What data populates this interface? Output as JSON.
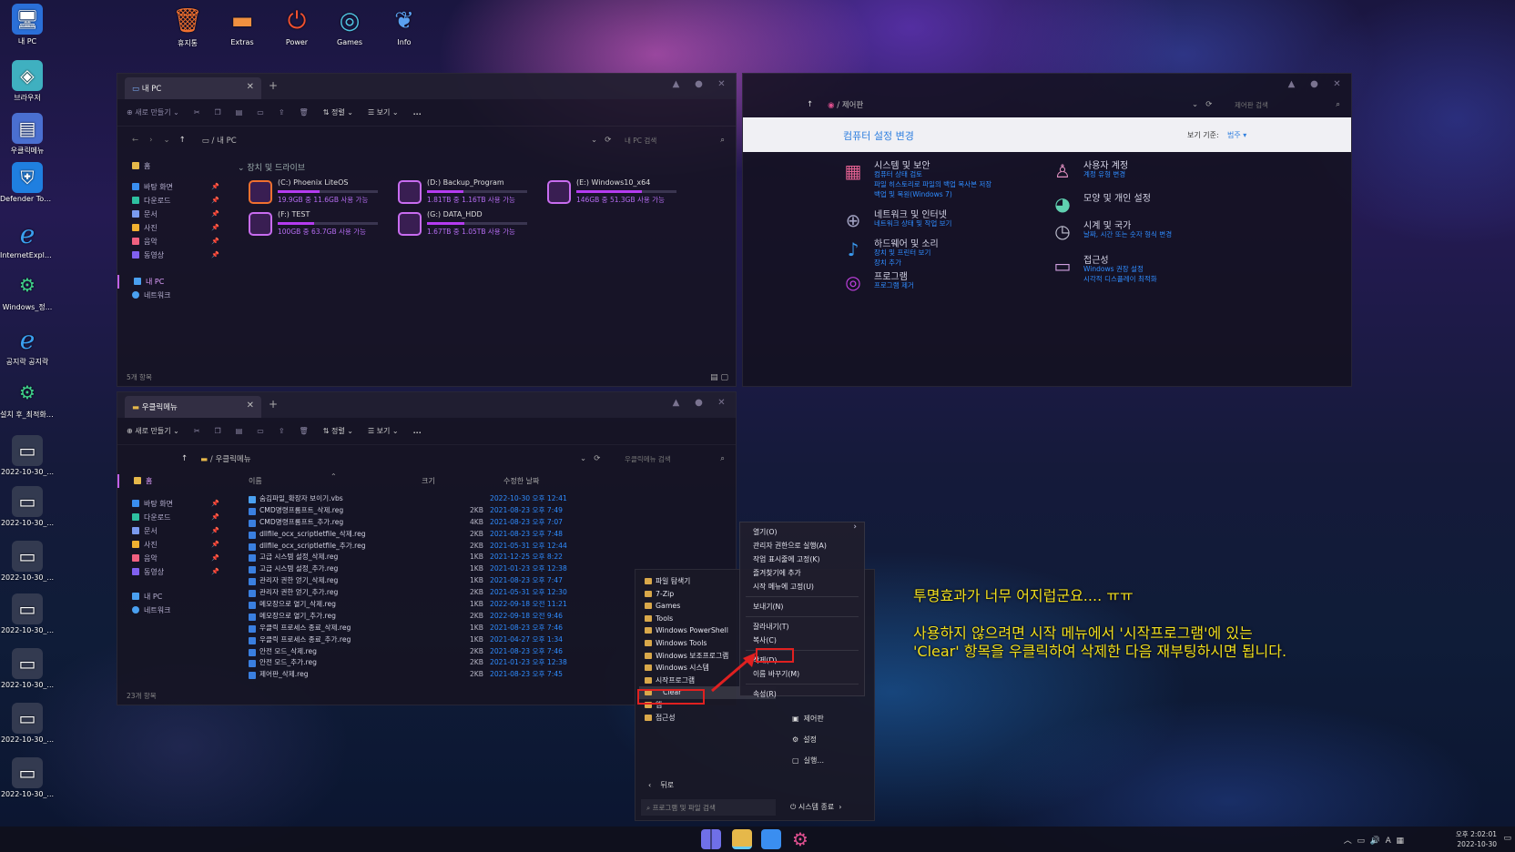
{
  "desktop": {
    "left_icons": [
      {
        "label": "내 PC",
        "icon": "monitor-icon"
      },
      {
        "label": "브라우저",
        "icon": "browser-icon"
      },
      {
        "label": "우클릭메뉴",
        "icon": "context-menu-icon"
      },
      {
        "label": "Defender Tools.exe",
        "icon": "shield-icon"
      },
      {
        "label": "InternetExplor...",
        "icon": "ie-icon"
      },
      {
        "label": "Windows_정...",
        "icon": "gear-icon"
      },
      {
        "label": "공지락 공지락",
        "icon": "ie-icon"
      },
      {
        "label": "설치 후_최적화.cmd",
        "icon": "gear-icon"
      },
      {
        "label": "2022-10-30_...",
        "icon": "screenshot-icon"
      },
      {
        "label": "2022-10-30_...",
        "icon": "screenshot-icon"
      },
      {
        "label": "2022-10-30_...",
        "icon": "screenshot-icon"
      },
      {
        "label": "2022-10-30_...",
        "icon": "screenshot-icon"
      },
      {
        "label": "2022-10-30_...",
        "icon": "screenshot-icon"
      },
      {
        "label": "2022-10-30_...",
        "icon": "screenshot-icon"
      },
      {
        "label": "2022-10-30_...",
        "icon": "screenshot-icon"
      }
    ],
    "top_icons": [
      {
        "label": "휴지통",
        "icon": "trash-icon"
      },
      {
        "label": "Extras",
        "icon": "folder-icon"
      },
      {
        "label": "Power",
        "icon": "power-icon"
      },
      {
        "label": "Games",
        "icon": "gamepad-icon"
      },
      {
        "label": "Info",
        "icon": "bird-icon"
      }
    ]
  },
  "explorer1": {
    "tab": "내 PC",
    "toolbar": {
      "new": "새로 만들기",
      "sort": "정렬",
      "view": "보기",
      "more": "..."
    },
    "address": "내 PC",
    "search_placeholder": "내 PC 검색",
    "nav": {
      "home": "홈",
      "items": [
        "바탕 화면",
        "다운로드",
        "문서",
        "사진",
        "음악",
        "동영상"
      ],
      "pc": "내 PC",
      "network": "네트워크"
    },
    "section": "장치 및 드라이브",
    "drives": [
      {
        "name": "(C:) Phoenix LiteOS",
        "space": "19.9GB 중 11.6GB 사용 가능",
        "used": 0.42
      },
      {
        "name": "(D:) Backup_Program",
        "space": "1.81TB 중 1.16TB 사용 가능",
        "used": 0.36
      },
      {
        "name": "(E:) Windows10_x64",
        "space": "146GB 중 51.3GB 사용 가능",
        "used": 0.65
      },
      {
        "name": "(F:) TEST",
        "space": "100GB 중 63.7GB 사용 가능",
        "used": 0.36
      },
      {
        "name": "(G:) DATA_HDD",
        "space": "1.67TB 중 1.05TB 사용 가능",
        "used": 0.37
      }
    ],
    "status": "5개 항목"
  },
  "controlpanel": {
    "address": "제어판",
    "search_placeholder": "제어판 검색",
    "heading": "컴퓨터 설정 변경",
    "view_by_label": "보기 기준:",
    "view_by_value": "범주",
    "items": [
      {
        "title": "시스템 및 보안",
        "subs": [
          "컴퓨터 상태 검토",
          "파일 히스토리로 파일의 백업 복사본 저장",
          "백업 및 복원(Windows 7)"
        ]
      },
      {
        "title": "네트워크 및 인터넷",
        "subs": [
          "네트워크 상태 및 작업 보기"
        ]
      },
      {
        "title": "하드웨어 및 소리",
        "subs": [
          "장치 및 프린터 보기",
          "장치 추가"
        ]
      },
      {
        "title": "프로그램",
        "subs": [
          "프로그램 제거"
        ]
      },
      {
        "title": "사용자 계정",
        "subs": [
          "계정 유형 변경"
        ]
      },
      {
        "title": "모양 및 개인 설정",
        "subs": []
      },
      {
        "title": "시계 및 국가",
        "subs": [
          "날짜, 시간 또는 숫자 형식 변경"
        ]
      },
      {
        "title": "접근성",
        "subs": [
          "Windows 권장 설정",
          "시각적 디스플레이 최적화"
        ]
      }
    ]
  },
  "explorer2": {
    "tab": "우클릭메뉴",
    "toolbar": {
      "new": "새로 만들기",
      "sort": "정렬",
      "view": "보기",
      "more": "..."
    },
    "address": "우클릭메뉴",
    "search_placeholder": "우클릭메뉴 검색",
    "nav": {
      "home": "홈",
      "items": [
        "바탕 화면",
        "다운로드",
        "문서",
        "사진",
        "음악",
        "동영상"
      ],
      "pc": "내 PC",
      "network": "네트워크"
    },
    "columns": {
      "name": "이름",
      "size": "크기",
      "date": "수정한 날짜"
    },
    "files": [
      {
        "name": "숨김파일_확장자 보이기.vbs",
        "size": "",
        "date": "2022-10-30 오후 12:41"
      },
      {
        "name": "CMD명령프롬프트_삭제.reg",
        "size": "2KB",
        "date": "2021-08-23 오후 7:49"
      },
      {
        "name": "CMD명령프롬프트_추가.reg",
        "size": "4KB",
        "date": "2021-08-23 오후 7:07"
      },
      {
        "name": "dllfile_ocx_scriptletfile_삭제.reg",
        "size": "2KB",
        "date": "2021-08-23 오후 7:48"
      },
      {
        "name": "dllfile_ocx_scriptletfile_추가.reg",
        "size": "2KB",
        "date": "2021-05-31 오후 12:44"
      },
      {
        "name": "고급 시스템 설정_삭제.reg",
        "size": "1KB",
        "date": "2021-12-25 오후 8:22"
      },
      {
        "name": "고급 시스템 설정_추가.reg",
        "size": "1KB",
        "date": "2021-01-23 오후 12:38"
      },
      {
        "name": "관리자 권한 얻기_삭제.reg",
        "size": "1KB",
        "date": "2021-08-23 오후 7:47"
      },
      {
        "name": "관리자 권한 얻기_추가.reg",
        "size": "2KB",
        "date": "2021-05-31 오후 12:30"
      },
      {
        "name": "메모장으로 열기_삭제.reg",
        "size": "1KB",
        "date": "2022-09-18 오전 11:21"
      },
      {
        "name": "메모장으로 열기_추가.reg",
        "size": "2KB",
        "date": "2022-09-18 오전 9:46"
      },
      {
        "name": "우클릭 프로세스 종료_삭제.reg",
        "size": "1KB",
        "date": "2021-08-23 오후 7:46"
      },
      {
        "name": "우클릭 프로세스 종료_추가.reg",
        "size": "1KB",
        "date": "2021-04-27 오후 1:34"
      },
      {
        "name": "안전 모드_삭제.reg",
        "size": "2KB",
        "date": "2021-08-23 오후 7:46"
      },
      {
        "name": "안전 모드_추가.reg",
        "size": "2KB",
        "date": "2021-01-23 오후 12:38"
      },
      {
        "name": "제어판_삭제.reg",
        "size": "2KB",
        "date": "2021-08-23 오후 7:45"
      }
    ],
    "status": "23개 항목"
  },
  "startmenu": {
    "folders": [
      "파일 탐색기",
      "7-Zip",
      "Games",
      "Tools",
      "Windows PowerShell",
      "Windows Tools",
      "Windows 보조프로그램",
      "Windows 시스템",
      "시작프로그램",
      "Clear",
      "앱",
      "접근성"
    ],
    "back": "뒤로",
    "search_placeholder": "프로그램 및 파일 검색",
    "right": [
      "제어판",
      "설정",
      "실행..."
    ],
    "shutdown": "시스템 종료"
  },
  "context_menu": [
    "열기(O)",
    "관리자 권한으로 실행(A)",
    "작업 표시줄에 고정(K)",
    "즐겨찾기에 추가",
    "시작 메뉴에 고정(U)",
    "보내기(N)",
    "잘라내기(T)",
    "복사(C)",
    "삭제(D)",
    "이름 바꾸기(M)",
    "속성(R)"
  ],
  "overlay": {
    "line1": "투명효과가 너무 어지럽군요.... ㅠㅠ",
    "line2": "사용하지 않으려면 시작 메뉴에서 '시작프로그램'에 있는",
    "line3": "'Clear' 항목을 우클릭하여 삭제한 다음 재부팅하시면 됩니다."
  },
  "taskbar": {
    "time": "오후 2:02:01",
    "date": "2022-10-30",
    "lang": "A"
  }
}
